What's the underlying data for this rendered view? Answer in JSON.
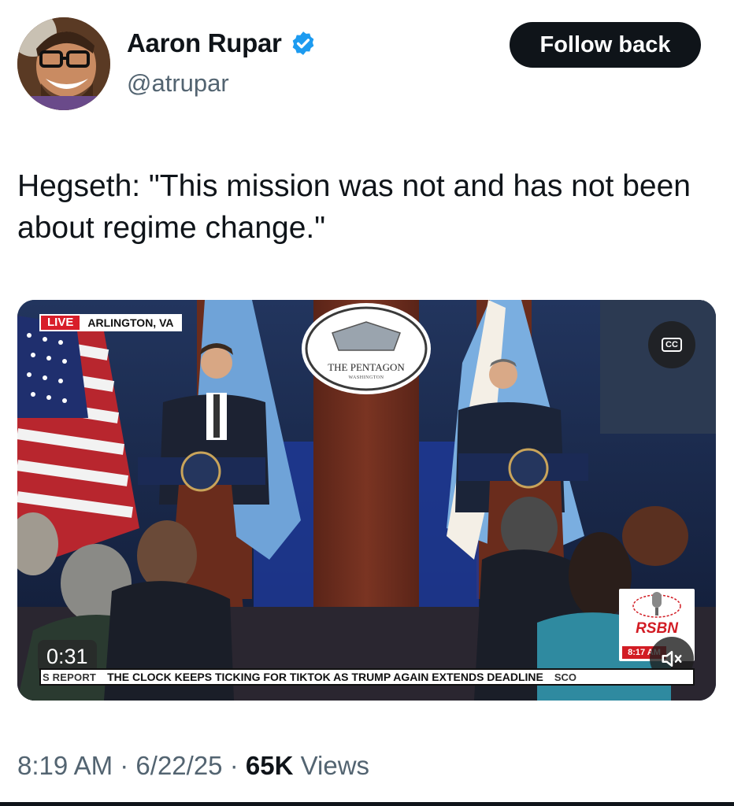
{
  "author": {
    "name": "Aaron Rupar",
    "handle": "@atrupar",
    "verified": true,
    "avatar_icon": "avatar-photo"
  },
  "follow_button": {
    "label": "Follow back"
  },
  "tweet": {
    "text": "Hegseth: \"This mission was not and has not been about regime change.\""
  },
  "video": {
    "live_label": "LIVE",
    "location": "ARLINGTON, VA",
    "podium_seal": "THE PENTAGON",
    "podium_seal_sub": "WASHINGTON",
    "cc_label": "CC",
    "watermark": "RSBN",
    "watermark_time": "8:17 AM",
    "elapsed": "0:31",
    "ticker_segment": "S REPORT",
    "ticker_headline": "THE CLOCK KEEPS TICKING FOR TIKTOK AS TRUMP AGAIN EXTENDS DEADLINE",
    "ticker_tail": "SCO",
    "mute_icon": "speaker-muted-icon"
  },
  "meta": {
    "time": "8:19 AM",
    "date": "6/22/25",
    "views_count": "65K",
    "views_label": "Views",
    "separator": "·"
  },
  "colors": {
    "text_primary": "#0f1419",
    "text_secondary": "#536471",
    "verified_blue": "#1d9bf0",
    "live_red": "#d81e2a"
  }
}
